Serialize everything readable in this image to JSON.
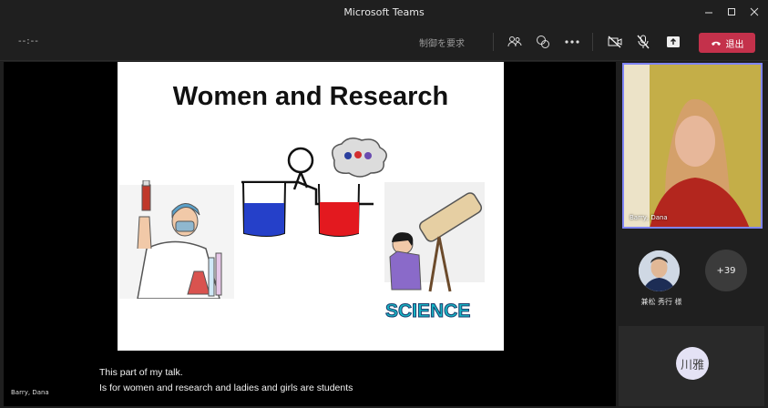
{
  "window": {
    "title": "Microsoft Teams"
  },
  "toolbar": {
    "timer": "--:--",
    "request_control": "制御を要求",
    "leave_label": "退出"
  },
  "slide": {
    "title": "Women and Research",
    "science_label": "SCIENCE"
  },
  "captions": [
    "This part of my talk.",
    "Is for women and research and ladies and girls are students"
  ],
  "presenter_label": "Barry, Dana",
  "participants": {
    "video_name": "Barry, Dana",
    "second_name": "兼松 秀行 様",
    "overflow_count": "+39",
    "bottom_initials": "川雅"
  },
  "icons": [
    "minimize-icon",
    "maximize-icon",
    "close-icon",
    "people-icon",
    "chat-icon",
    "more-icon",
    "camera-off-icon",
    "mic-off-icon",
    "share-icon",
    "phone-icon"
  ],
  "colors": {
    "leave": "#c4314b",
    "active_border": "#7f85f5",
    "background": "#1f1f1f"
  }
}
